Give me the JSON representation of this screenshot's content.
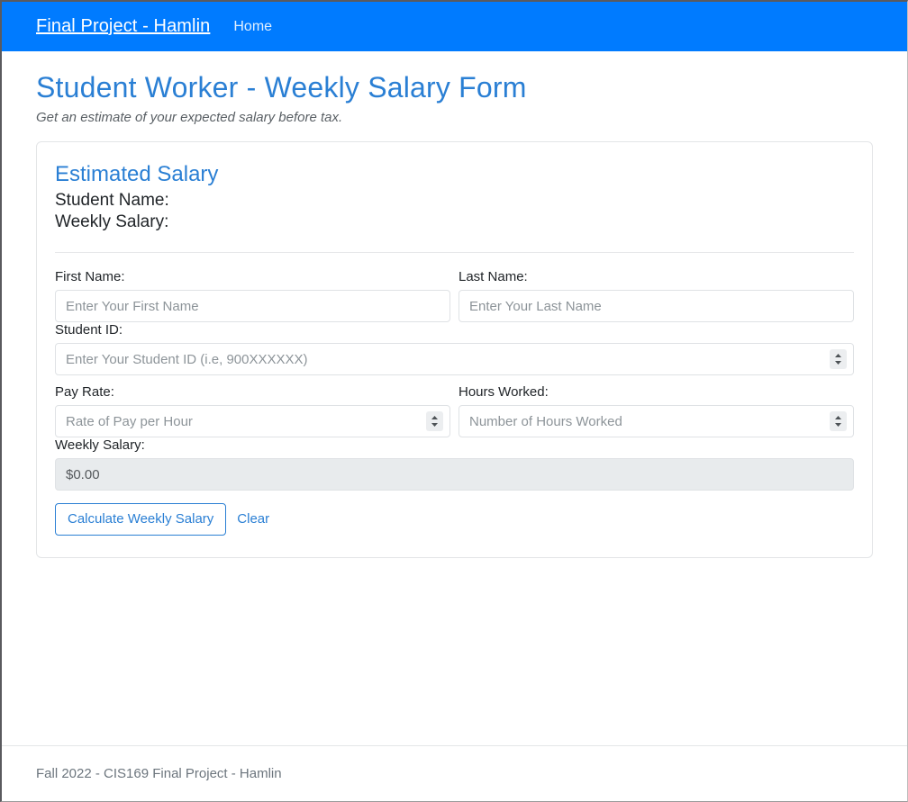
{
  "navbar": {
    "brand": "Final Project - Hamlin",
    "links": [
      {
        "label": "Home"
      }
    ],
    "background_color": "#007bff"
  },
  "page": {
    "title": "Student Worker - Weekly Salary Form",
    "subtitle": "Get an estimate of your expected salary before tax.",
    "accent_color": "#2a7fd4"
  },
  "card": {
    "heading": "Estimated Salary",
    "results": [
      {
        "label": "Student Name:"
      },
      {
        "label": "Weekly Salary:"
      }
    ],
    "fields": {
      "first_name": {
        "label": "First Name:",
        "placeholder": "Enter Your First Name",
        "value": ""
      },
      "last_name": {
        "label": "Last Name:",
        "placeholder": "Enter Your Last Name",
        "value": ""
      },
      "student_id": {
        "label": "Student ID:",
        "placeholder": "Enter Your Student ID (i.e, 900XXXXXX)",
        "value": ""
      },
      "pay_rate": {
        "label": "Pay Rate:",
        "placeholder": "Rate of Pay per Hour",
        "value": ""
      },
      "hours_worked": {
        "label": "Hours Worked:",
        "placeholder": "Number of Hours Worked",
        "value": ""
      },
      "weekly_salary": {
        "label": "Weekly Salary:",
        "value": "$0.00"
      }
    },
    "buttons": {
      "calculate": "Calculate Weekly Salary",
      "clear": "Clear"
    }
  },
  "footer": {
    "text": "Fall 2022 - CIS169 Final Project - Hamlin"
  }
}
